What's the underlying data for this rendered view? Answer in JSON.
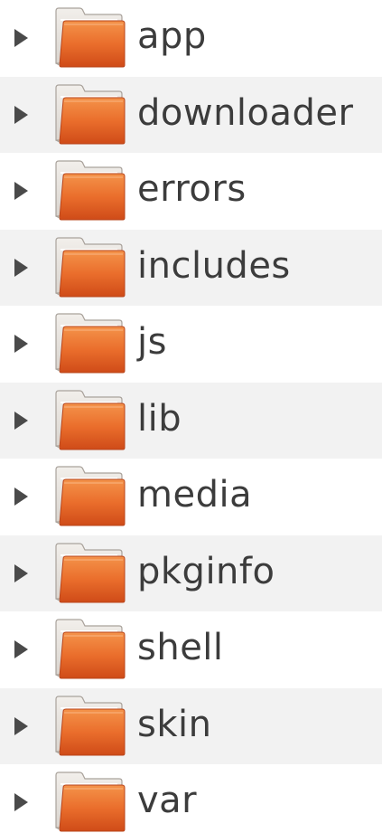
{
  "tree": {
    "items": [
      {
        "label": "app"
      },
      {
        "label": "downloader"
      },
      {
        "label": "errors"
      },
      {
        "label": "includes"
      },
      {
        "label": "js"
      },
      {
        "label": "lib"
      },
      {
        "label": "media"
      },
      {
        "label": "pkginfo"
      },
      {
        "label": "shell"
      },
      {
        "label": "skin"
      },
      {
        "label": "var"
      }
    ]
  },
  "icons": {
    "expander": "triangle-right-icon",
    "folder": "folder-icon"
  },
  "colors": {
    "folder_front_top": "#f0833a",
    "folder_front_bottom": "#d2501a",
    "folder_back": "#e8e4df",
    "alt_row_background": "#f2f2f2",
    "text": "#3c3c3c"
  }
}
